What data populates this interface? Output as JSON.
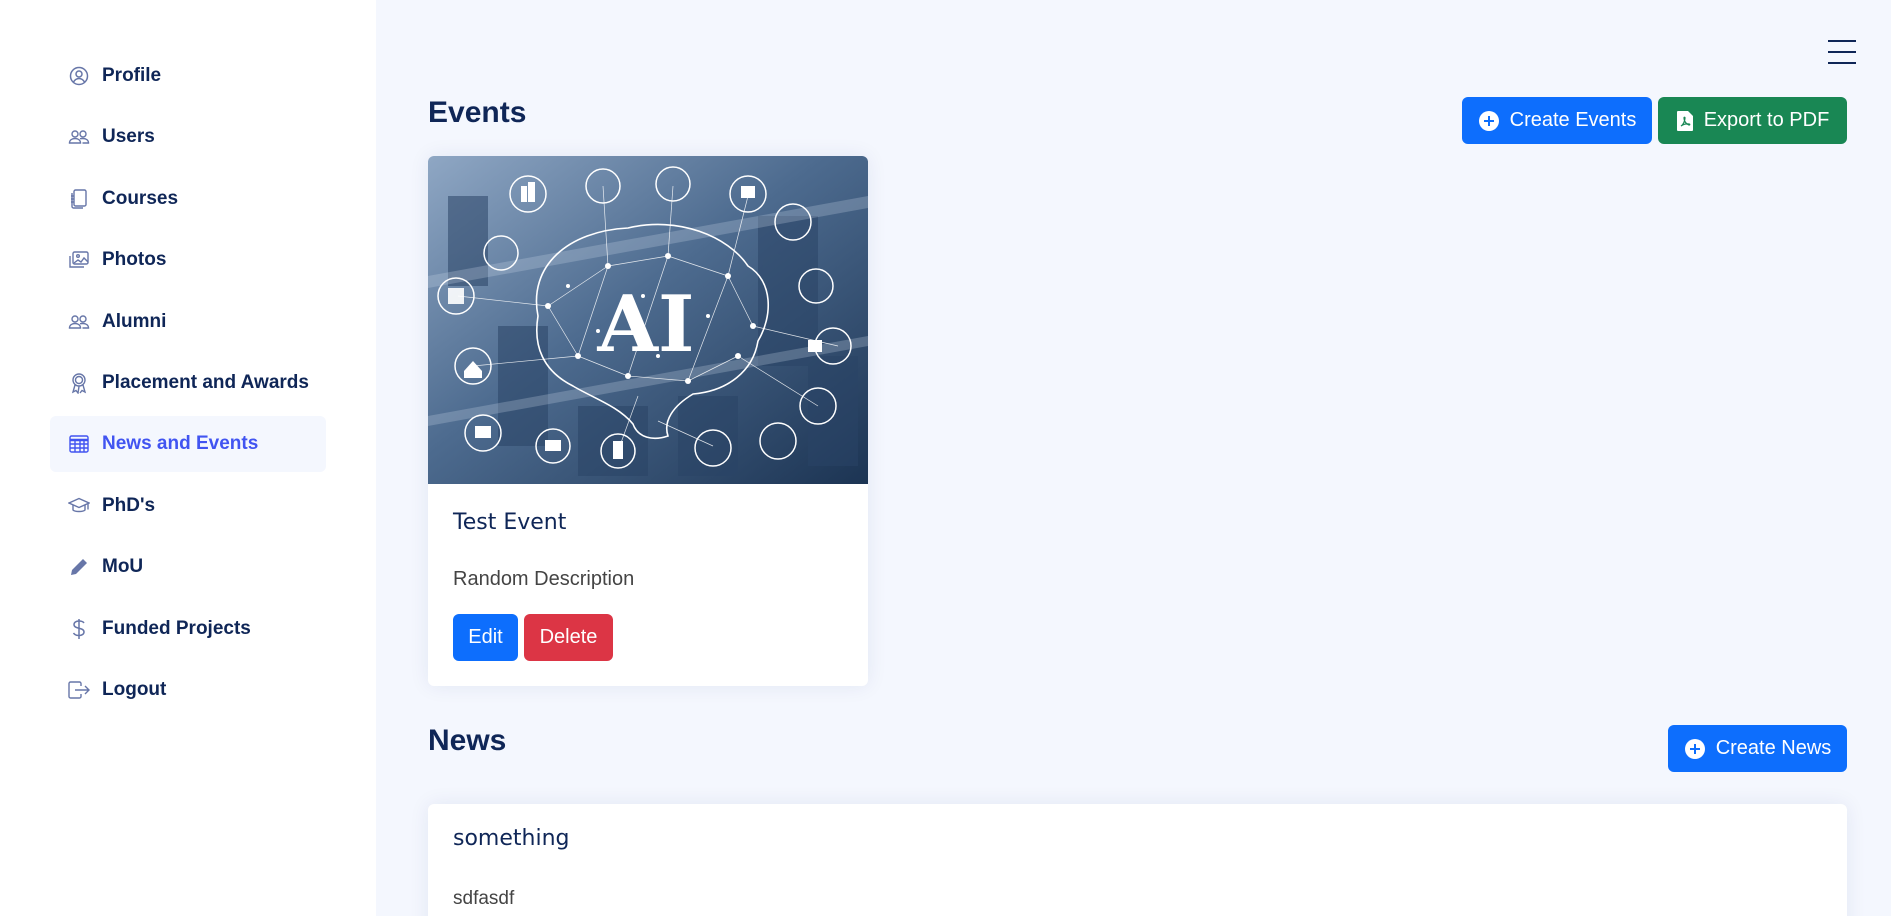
{
  "sidebar": {
    "items": [
      {
        "label": "Profile",
        "icon": "person-circle-icon",
        "active": false
      },
      {
        "label": "Users",
        "icon": "people-icon",
        "active": false
      },
      {
        "label": "Courses",
        "icon": "journals-icon",
        "active": false
      },
      {
        "label": "Photos",
        "icon": "images-icon",
        "active": false
      },
      {
        "label": "Alumni",
        "icon": "people-icon",
        "active": false
      },
      {
        "label": "Placement and Awards",
        "icon": "award-icon",
        "active": false
      },
      {
        "label": "News and Events",
        "icon": "calendar-table-icon",
        "active": true
      },
      {
        "label": "PhD's",
        "icon": "mortarboard-icon",
        "active": false
      },
      {
        "label": "MoU",
        "icon": "pen-icon",
        "active": false
      },
      {
        "label": "Funded Projects",
        "icon": "dollar-icon",
        "active": false
      },
      {
        "label": "Logout",
        "icon": "box-arrow-right-icon",
        "active": false
      }
    ]
  },
  "events": {
    "title": "Events",
    "create_label": "Create Events",
    "export_label": "Export to PDF",
    "cards": [
      {
        "title": "Test Event",
        "description": "Random Description",
        "image_text": "AI",
        "edit_label": "Edit",
        "delete_label": "Delete"
      }
    ]
  },
  "news": {
    "title": "News",
    "create_label": "Create News",
    "items": [
      {
        "title": "something",
        "description": "sdfasdf"
      }
    ]
  },
  "colors": {
    "primary": "#0d6efd",
    "success": "#198754",
    "danger": "#dc3545",
    "nav_text": "#0f2657",
    "nav_active": "#4154f1",
    "background": "#f4f7fe"
  }
}
